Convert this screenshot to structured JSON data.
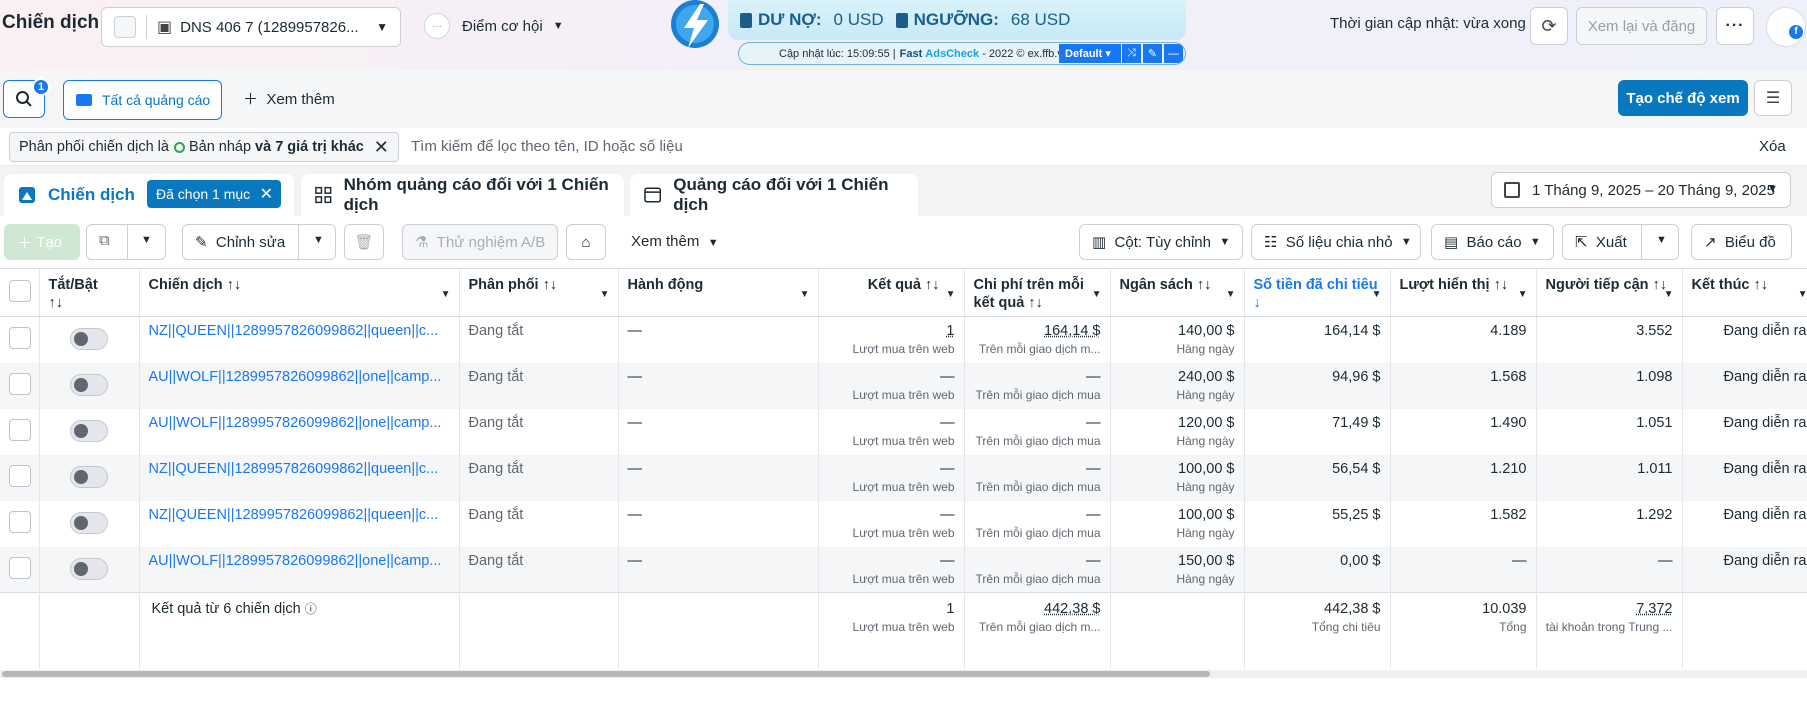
{
  "header": {
    "title": "Chiến dịch",
    "account": "DNS 406 7 (1289957826...",
    "opportunity": "Điểm cơ hội",
    "updated": "Thời gian cập nhật: vừa xong",
    "review_publish": "Xem lại và đăng"
  },
  "extension": {
    "debt_label": "DƯ NỢ:",
    "debt_value": "0 USD",
    "threshold_label": "NGƯỠNG:",
    "threshold_value": "68 USD",
    "update_prefix": "Cập nhật lúc: 15:09:55 |",
    "brand_fast": "Fast",
    "brand_ads": "AdsCheck",
    "copyright": "- 2022 © ex.ffb.vn",
    "profile": "Default"
  },
  "toolbar": {
    "search_badge": "1",
    "all_ads": "Tất cả quảng cáo",
    "see_more": "Xem thêm",
    "create_view": "Tạo chế độ xem"
  },
  "filter": {
    "chip_prefix": "Phân phối chiến dịch là",
    "chip_value": "Bản nháp",
    "chip_more": "và 7 giá trị khác",
    "search_placeholder": "Tìm kiếm để lọc theo tên, ID hoặc số liệu",
    "clear": "Xóa"
  },
  "tabs": {
    "campaigns": "Chiến dịch",
    "selected": "Đã chọn 1 mục",
    "adsets": "Nhóm quảng cáo đối với 1 Chiến dịch",
    "ads": "Quảng cáo đối với 1 Chiến dịch",
    "date_range": "1 Tháng 9, 2025 – 20 Tháng 9, 2025"
  },
  "actions": {
    "create": "Tạo",
    "edit": "Chỉnh sửa",
    "ab_test": "Thử nghiệm A/B",
    "see_more": "Xem thêm",
    "columns": "Cột: Tùy chỉnh",
    "breakdown": "Số liệu chia nhỏ",
    "reports": "Báo cáo",
    "export": "Xuất",
    "charts": "Biểu đồ"
  },
  "table": {
    "headers": {
      "toggle": "Tắt/Bật",
      "campaign": "Chiến dịch",
      "delivery": "Phân phối",
      "actions": "Hành động",
      "results": "Kết quả",
      "cost": "Chi phí trên mỗi kết quả",
      "budget": "Ngân sách",
      "spent": "Số tiền đã chi tiêu",
      "impressions": "Lượt hiển thị",
      "reach": "Người tiếp cận",
      "ends": "Kết thúc"
    },
    "sort_icon": "↑↓",
    "sort_down": "↓",
    "rows": [
      {
        "name": "NZ||QUEEN||1289957826099862||queen||c...",
        "delivery": "Đang tắt",
        "action": "—",
        "results": "1",
        "results_sub": "Lượt mua trên web",
        "cost": "164,14 $",
        "cost_sub": "Trên mỗi giao dịch m...",
        "budget": "140,00 $",
        "budget_sub": "Hàng ngày",
        "spent": "164,14 $",
        "impressions": "4.189",
        "reach": "3.552",
        "ends": "Đang diễn ra"
      },
      {
        "name": "AU||WOLF||1289957826099862||one||camp...",
        "delivery": "Đang tắt",
        "action": "—",
        "results": "—",
        "results_sub": "Lượt mua trên web",
        "cost": "—",
        "cost_sub": "Trên mỗi giao dịch mua",
        "budget": "240,00 $",
        "budget_sub": "Hàng ngày",
        "spent": "94,96 $",
        "impressions": "1.568",
        "reach": "1.098",
        "ends": "Đang diễn ra"
      },
      {
        "name": "AU||WOLF||1289957826099862||one||camp...",
        "delivery": "Đang tắt",
        "action": "—",
        "results": "—",
        "results_sub": "Lượt mua trên web",
        "cost": "—",
        "cost_sub": "Trên mỗi giao dịch mua",
        "budget": "120,00 $",
        "budget_sub": "Hàng ngày",
        "spent": "71,49 $",
        "impressions": "1.490",
        "reach": "1.051",
        "ends": "Đang diễn ra"
      },
      {
        "name": "NZ||QUEEN||1289957826099862||queen||c...",
        "delivery": "Đang tắt",
        "action": "—",
        "results": "—",
        "results_sub": "Lượt mua trên web",
        "cost": "—",
        "cost_sub": "Trên mỗi giao dịch mua",
        "budget": "100,00 $",
        "budget_sub": "Hàng ngày",
        "spent": "56,54 $",
        "impressions": "1.210",
        "reach": "1.011",
        "ends": "Đang diễn ra"
      },
      {
        "name": "NZ||QUEEN||1289957826099862||queen||c...",
        "delivery": "Đang tắt",
        "action": "—",
        "results": "—",
        "results_sub": "Lượt mua trên web",
        "cost": "—",
        "cost_sub": "Trên mỗi giao dịch mua",
        "budget": "100,00 $",
        "budget_sub": "Hàng ngày",
        "spent": "55,25 $",
        "impressions": "1.582",
        "reach": "1.292",
        "ends": "Đang diễn ra"
      },
      {
        "name": "AU||WOLF||1289957826099862||one||camp...",
        "delivery": "Đang tắt",
        "action": "—",
        "results": "—",
        "results_sub": "Lượt mua trên web",
        "cost": "—",
        "cost_sub": "Trên mỗi giao dịch mua",
        "budget": "150,00 $",
        "budget_sub": "Hàng ngày",
        "spent": "0,00 $",
        "impressions": "—",
        "reach": "—",
        "ends": "Đang diễn ra"
      }
    ],
    "footer": {
      "label": "Kết quả từ 6 chiến dịch",
      "results": "1",
      "results_sub": "Lượt mua trên web",
      "cost": "442,38 $",
      "cost_sub": "Trên mỗi giao dịch m...",
      "spent": "442,38 $",
      "spent_sub": "Tổng chi tiêu",
      "impressions": "10.039",
      "impressions_sub": "Tổng",
      "reach": "7.372",
      "reach_sub": "tài khoản trong Trung ..."
    }
  },
  "colors": {
    "accent": "#1877f2",
    "primary_button": "#0a78be",
    "draft_dot": "#31a24c"
  }
}
